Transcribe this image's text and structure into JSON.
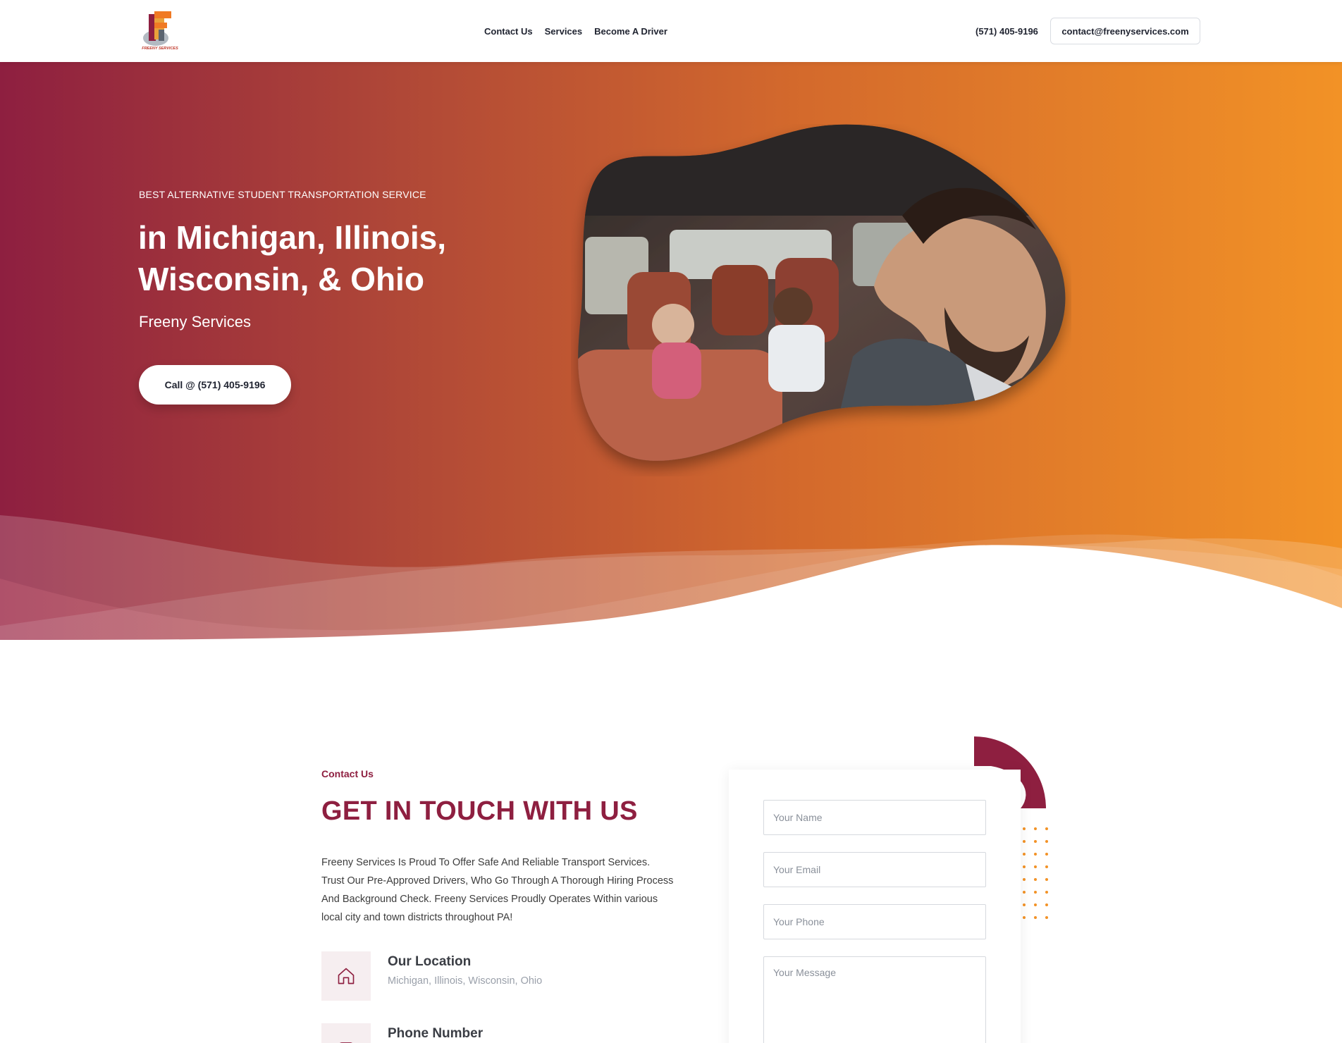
{
  "header": {
    "nav": [
      {
        "label": "Contact Us"
      },
      {
        "label": "Services"
      },
      {
        "label": "Become A Driver"
      }
    ],
    "phone": "(571) 405-9196",
    "email": "contact@freenyservices.com",
    "logo_text": "FREENY SERVICES"
  },
  "hero": {
    "eyebrow": "BEST ALTERNATIVE STUDENT TRANSPORTATION SERVICE",
    "headline_line1": "in Michigan, Illinois,",
    "headline_line2": "Wisconsin, & Ohio",
    "subhead": "Freeny Services",
    "cta_label": "Call @ (571) 405-9196"
  },
  "contact": {
    "eyebrow": "Contact Us",
    "title": "GET IN TOUCH WITH US",
    "description": "Freeny Services Is Proud To Offer Safe And Reliable Transport Services. Trust Our Pre-Approved Drivers, Who Go Through A Thorough Hiring Process And Background Check. Freeny Services Proudly Operates Within various local city and town districts throughout PA!",
    "location_title": "Our Location",
    "location_value": "Michigan, Illinois, Wisconsin, Ohio",
    "phone_title": "Phone Number"
  },
  "form": {
    "name_placeholder": "Your Name",
    "email_placeholder": "Your Email",
    "phone_placeholder": "Your Phone",
    "message_placeholder": "Your Message"
  },
  "colors": {
    "brand_primary": "#8e1f40",
    "brand_secondary": "#f29226",
    "icon_tint": "#f6eef0"
  },
  "icons": {
    "location": "home-icon",
    "phone": "phone-icon"
  }
}
